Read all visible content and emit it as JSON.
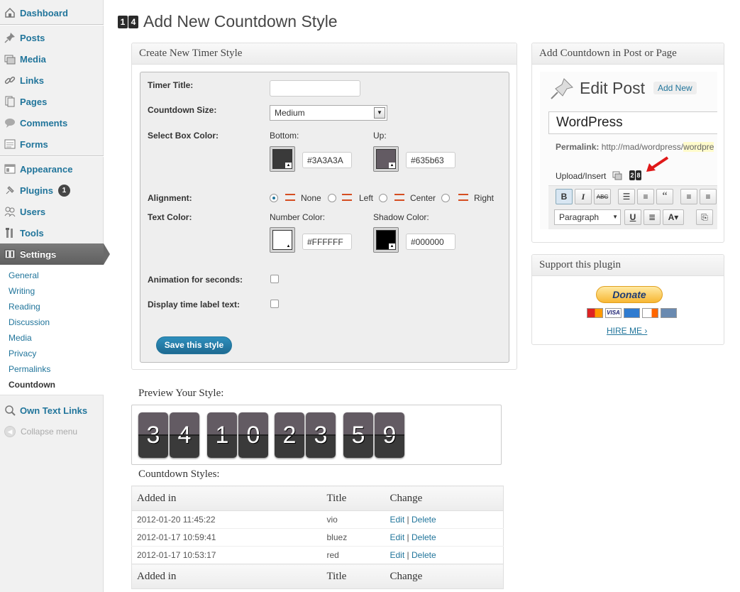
{
  "sidebar": {
    "items": [
      {
        "id": "dashboard",
        "label": "Dashboard",
        "icon": "dashboard-icon"
      },
      {
        "id": "posts",
        "label": "Posts",
        "icon": "pin-icon"
      },
      {
        "id": "media",
        "label": "Media",
        "icon": "media-icon"
      },
      {
        "id": "links",
        "label": "Links",
        "icon": "link-icon"
      },
      {
        "id": "pages",
        "label": "Pages",
        "icon": "pages-icon"
      },
      {
        "id": "comments",
        "label": "Comments",
        "icon": "comment-icon"
      },
      {
        "id": "forms",
        "label": "Forms",
        "icon": "forms-icon"
      },
      {
        "id": "appearance",
        "label": "Appearance",
        "icon": "appearance-icon"
      },
      {
        "id": "plugins",
        "label": "Plugins",
        "icon": "plugin-icon",
        "badge": "1"
      },
      {
        "id": "users",
        "label": "Users",
        "icon": "users-icon"
      },
      {
        "id": "tools",
        "label": "Tools",
        "icon": "tools-icon"
      },
      {
        "id": "settings",
        "label": "Settings",
        "icon": "settings-icon"
      }
    ],
    "submenu": [
      "General",
      "Writing",
      "Reading",
      "Discussion",
      "Media",
      "Privacy",
      "Permalinks",
      "Countdown"
    ],
    "extra": "Own Text Links",
    "collapse": "Collapse menu"
  },
  "header": {
    "logo_digits": [
      "1",
      "4"
    ],
    "title": "Add New Countdown Style"
  },
  "timer_form": {
    "heading": "Create New Timer Style",
    "title_label": "Timer Title:",
    "title_value": "",
    "size_label": "Countdown Size:",
    "size_value": "Medium",
    "box_color_label": "Select Box Color:",
    "bottom_label": "Bottom:",
    "bottom_color": "#3A3A3A",
    "up_label": "Up:",
    "up_color": "#635b63",
    "alignment_label": "Alignment:",
    "alignment_options": [
      "None",
      "Left",
      "Center",
      "Right"
    ],
    "alignment_selected": "None",
    "text_color_label": "Text Color:",
    "number_color_label": "Number Color:",
    "number_color": "#FFFFFF",
    "shadow_color_label": "Shadow Color:",
    "shadow_color": "#000000",
    "animation_label": "Animation for seconds:",
    "animation_checked": false,
    "time_label_label": "Display time label text:",
    "time_label_checked": false,
    "save_label": "Save this style"
  },
  "preview": {
    "heading": "Preview Your Style:",
    "digits": [
      "3",
      "4",
      "1",
      "0",
      "2",
      "3",
      "5",
      "9"
    ]
  },
  "styles_table": {
    "heading": "Countdown Styles:",
    "columns": [
      "Added in",
      "Title",
      "Change"
    ],
    "rows": [
      {
        "added": "2012-01-20 11:45:22",
        "title": "vio",
        "edit": "Edit",
        "sep": "|",
        "delete": "Delete"
      },
      {
        "added": "2012-01-17 10:59:41",
        "title": "bluez",
        "edit": "Edit",
        "sep": "|",
        "delete": "Delete"
      },
      {
        "added": "2012-01-17 10:53:17",
        "title": "red",
        "edit": "Edit",
        "sep": "|",
        "delete": "Delete"
      }
    ]
  },
  "insert_box": {
    "heading": "Add Countdown in Post or Page",
    "edit_post": "Edit Post",
    "add_new": "Add New",
    "post_title": "WordPress",
    "permalink_label": "Permalink:",
    "permalink_value": "http://mad/wordpress/",
    "permalink_highlight": "wordpre",
    "upload_label": "Upload/Insert",
    "icon_digits": [
      "2",
      "8"
    ],
    "format_value": "Paragraph"
  },
  "support_box": {
    "heading": "Support this plugin",
    "donate": "Donate",
    "hire": "HIRE ME ›"
  },
  "colors": {
    "link": "#21759b",
    "accent": "#d54e21",
    "digit_top": "#635b63",
    "digit_bottom": "#3A3A3A"
  }
}
